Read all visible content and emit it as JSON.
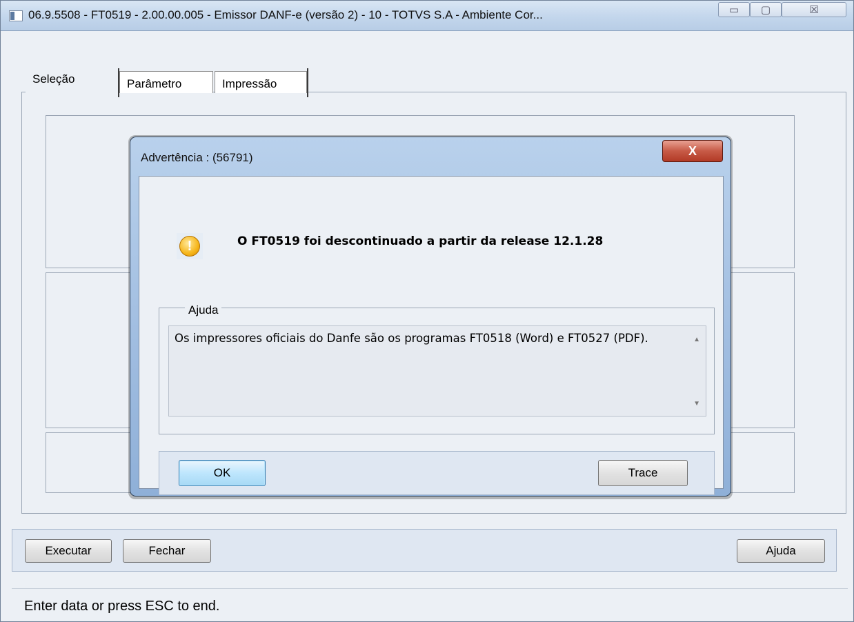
{
  "window": {
    "title": "06.9.5508 - FT0519 - 2.00.00.005 - Emissor DANF-e (versão 2) - 10 - TOTVS S.A - Ambiente Cor...",
    "minimize": "▭",
    "maximize": "▢",
    "close": "☒"
  },
  "tabs": [
    {
      "label": "Seleção"
    },
    {
      "label": "Parâmetro"
    },
    {
      "label": "Impressão"
    }
  ],
  "buttons": {
    "executar": "Executar",
    "fechar": "Fechar",
    "ajuda": "Ajuda"
  },
  "status": {
    "text": "Enter data or press ESC to end."
  },
  "dialog": {
    "title": "Advertência : (56791)",
    "close": "X",
    "icon": "warning-icon",
    "icon_glyph": "!",
    "message": "O FT0519 foi descontinuado a partir da release 12.1.28",
    "help_legend": "Ajuda",
    "help_text": "Os impressores oficiais do Danfe são os programas FT0518 (Word) e FT0527 (PDF).",
    "ok": "OK",
    "trace": "Trace"
  }
}
